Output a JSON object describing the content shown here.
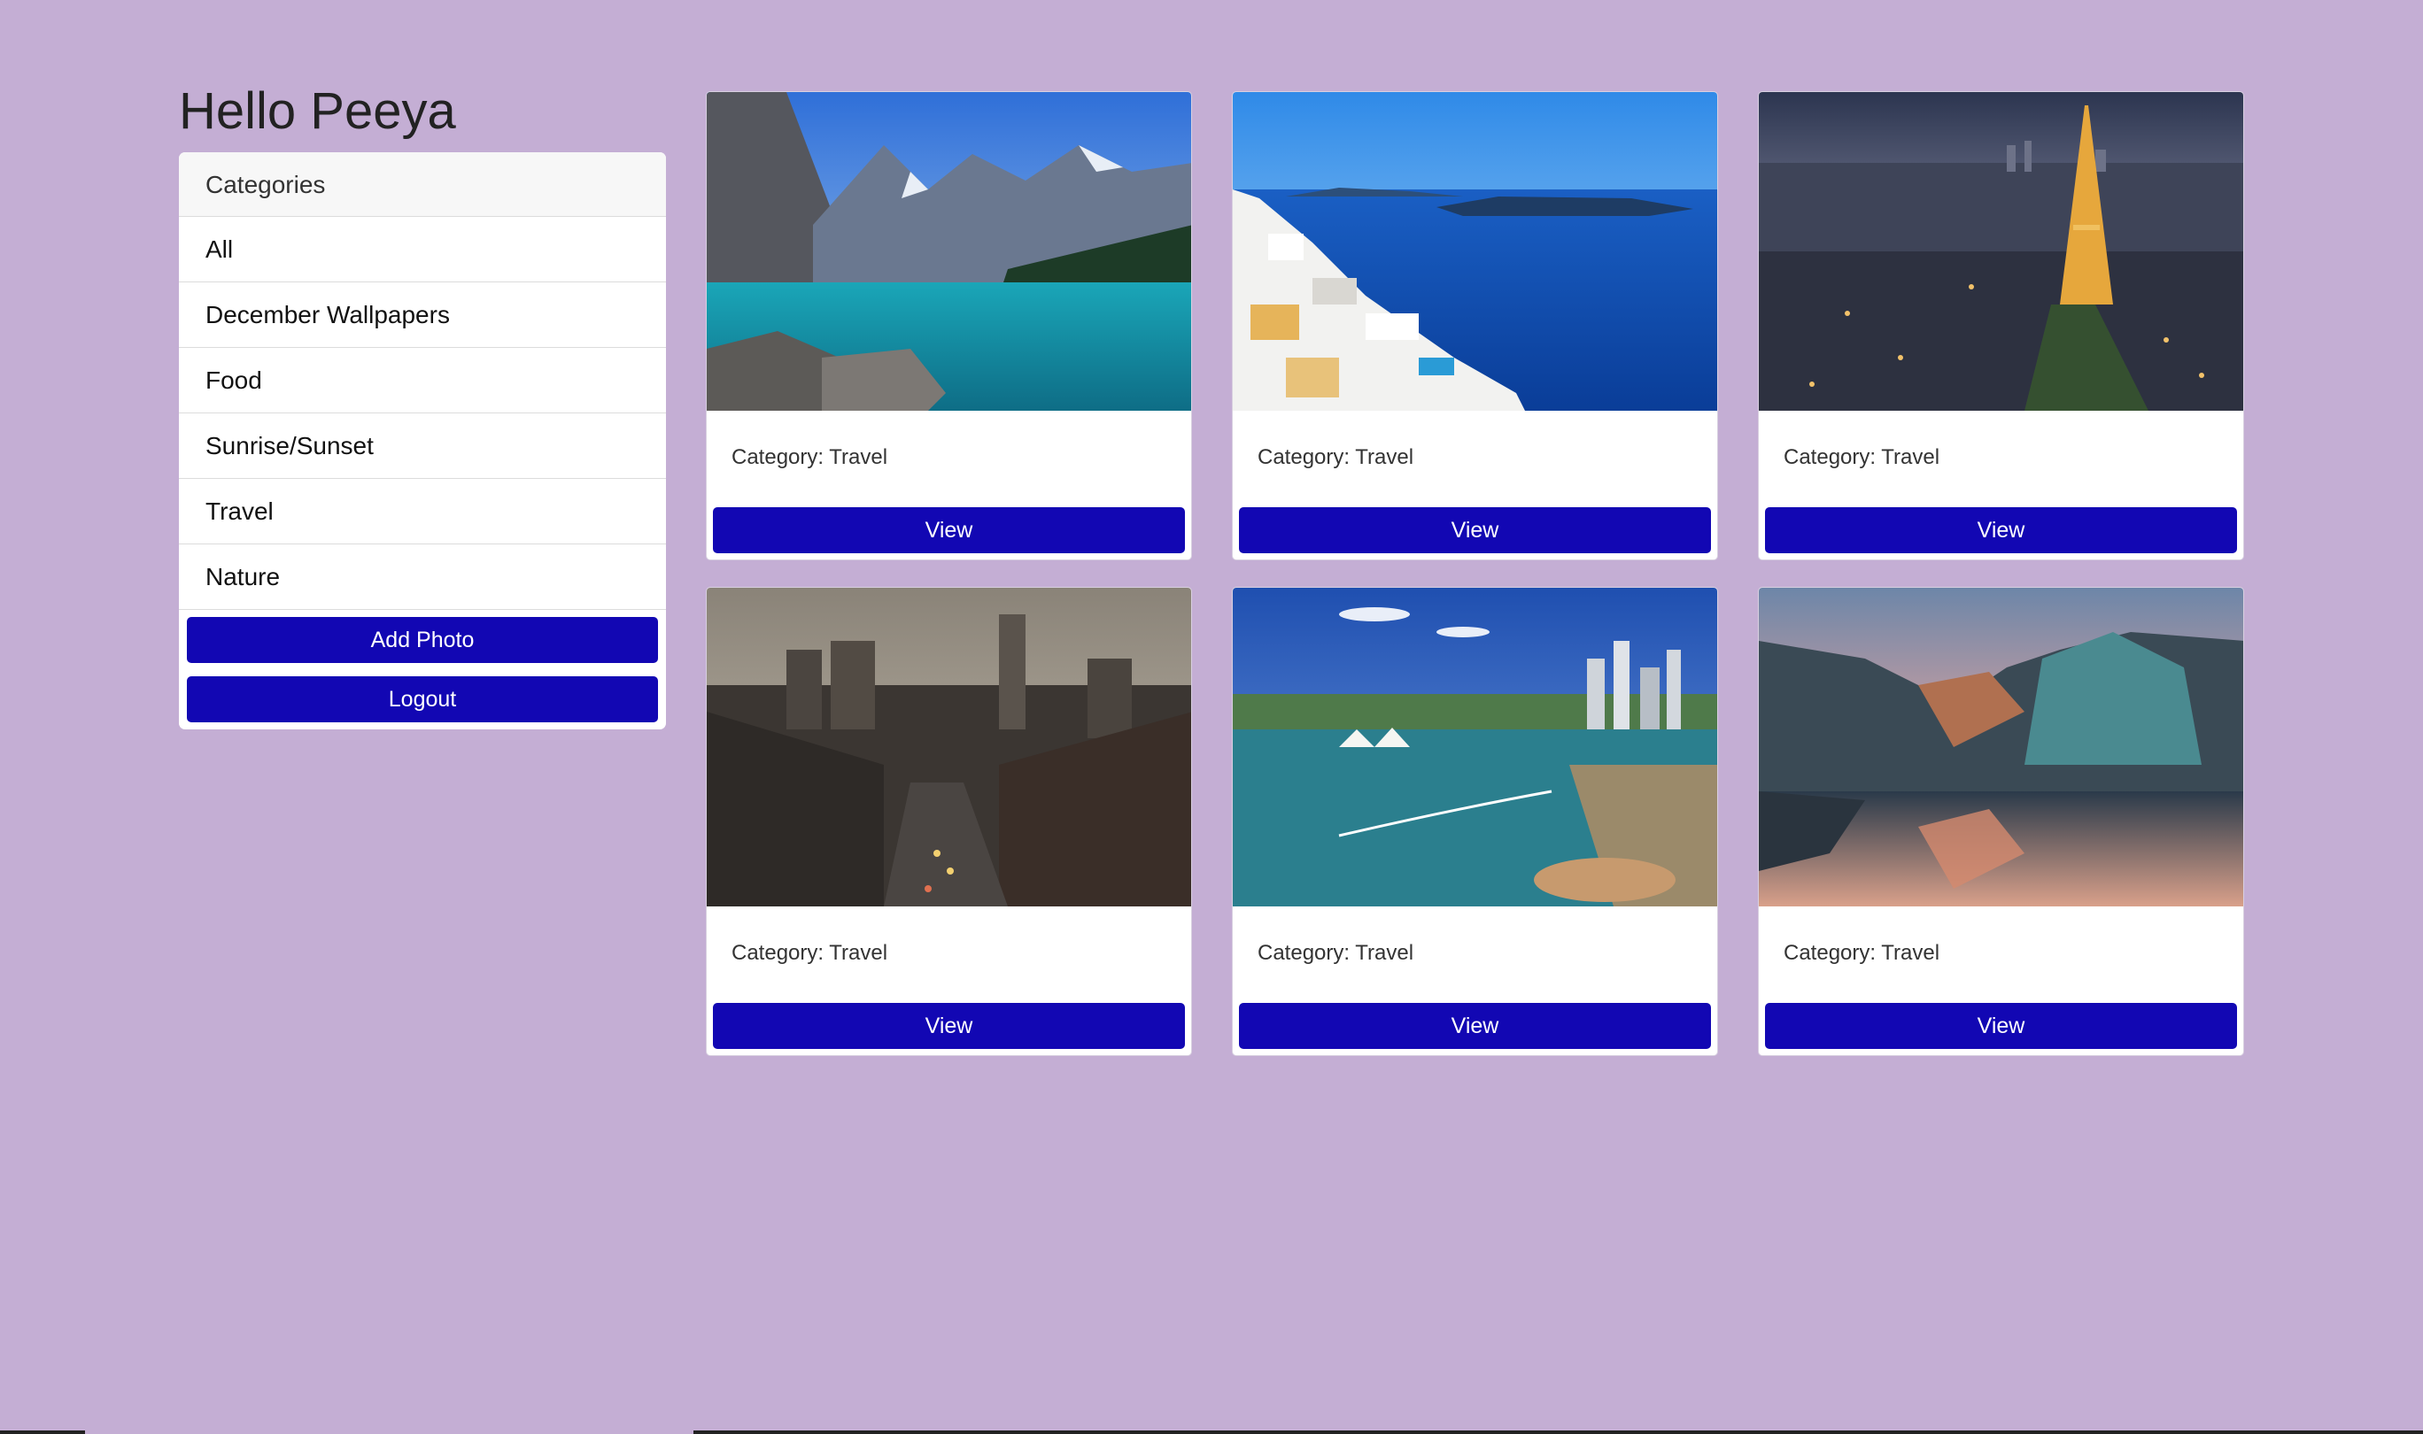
{
  "greeting": "Hello Peeya",
  "sidebar": {
    "header": "Categories",
    "items": [
      {
        "label": "All"
      },
      {
        "label": "December Wallpapers"
      },
      {
        "label": "Food"
      },
      {
        "label": "Sunrise/Sunset"
      },
      {
        "label": "Travel"
      },
      {
        "label": "Nature"
      }
    ],
    "add_photo_label": "Add Photo",
    "logout_label": "Logout"
  },
  "cards": [
    {
      "category_text": "Category: Travel",
      "button_label": "View"
    },
    {
      "category_text": "Category: Travel",
      "button_label": "View"
    },
    {
      "category_text": "Category: Travel",
      "button_label": "View"
    },
    {
      "category_text": "Category: Travel",
      "button_label": "View"
    },
    {
      "category_text": "Category: Travel",
      "button_label": "View"
    },
    {
      "category_text": "Category: Travel",
      "button_label": "View"
    }
  ],
  "colors": {
    "background": "#c4aed4",
    "button": "#1207b3",
    "card": "#ffffff"
  }
}
